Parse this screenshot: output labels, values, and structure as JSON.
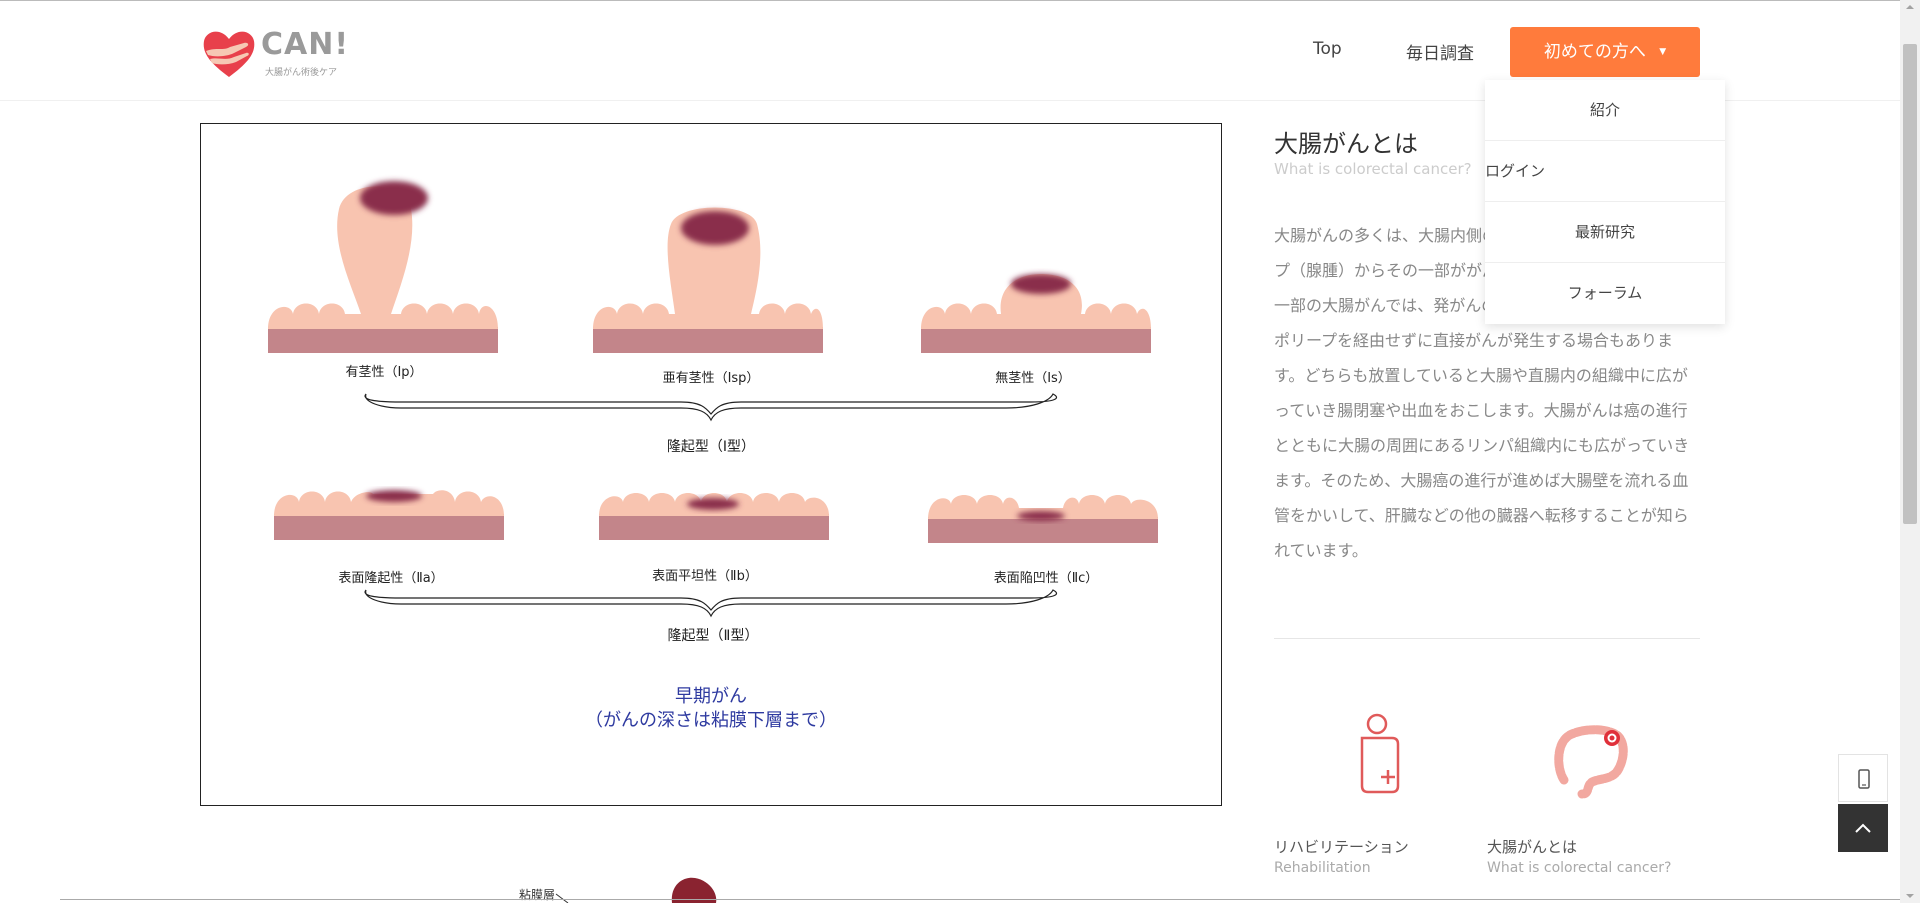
{
  "logo": {
    "title": "CAN!",
    "subtitle": "大腸がん術後ケア"
  },
  "nav": {
    "top_label": "Top",
    "daily_label": "毎日調査",
    "first_time_label": "初めての方へ",
    "dropdown_items": [
      "紹介",
      "ログイン",
      "最新研究",
      "フォーラム"
    ]
  },
  "figure": {
    "labels_row1": [
      "有茎性（Ⅰp）",
      "亜有茎性（Ⅰsp）",
      "無茎性（Ⅰs）"
    ],
    "group1": "隆起型（Ⅰ型）",
    "labels_row2": [
      "表面隆起性（Ⅱa）",
      "表面平坦性（Ⅱb）",
      "表面陥凹性（Ⅱc）"
    ],
    "group2": "隆起型（Ⅱ型）",
    "caption_line1": "早期がん",
    "caption_line2": "（がんの深さは粘膜下層まで）",
    "next_label": "粘膜層"
  },
  "article": {
    "title": "大腸がんとは",
    "subtitle": "What is colorectal cancer?",
    "body": "大腸がんの多くは、大腸内側の粘膜にできた良性のポリープ（腺腫）からその一部ががん化して発生します。また、一部の大腸がんでは、発がんの過程として正常粘膜から、ポリープを経由せずに直接がんが発生する場合もあります。どちらも放置していると大腸や直腸内の組織中に広がっていき腸閉塞や出血をおこします。大腸がんは癌の進行とともに大腸の周囲にあるリンパ組織内にも広がっていきます。そのため、大腸癌の進行が進めば大腸壁を流れる血管をかいして、肝臓などの他の臓器へ転移することが知られています。"
  },
  "cards": [
    {
      "title": "リハビリテーション",
      "subtitle": "Rehabilitation",
      "icon": "person-plus-icon"
    },
    {
      "title": "大腸がんとは",
      "subtitle": "What is colorectal cancer?",
      "icon": "colon-icon"
    }
  ],
  "colors": {
    "accent": "#ff7b3c",
    "caption": "#2e3aa0",
    "polyp": "#f8c4b0",
    "tumor": "#8a2d4c",
    "muscle": "#c3858a"
  }
}
